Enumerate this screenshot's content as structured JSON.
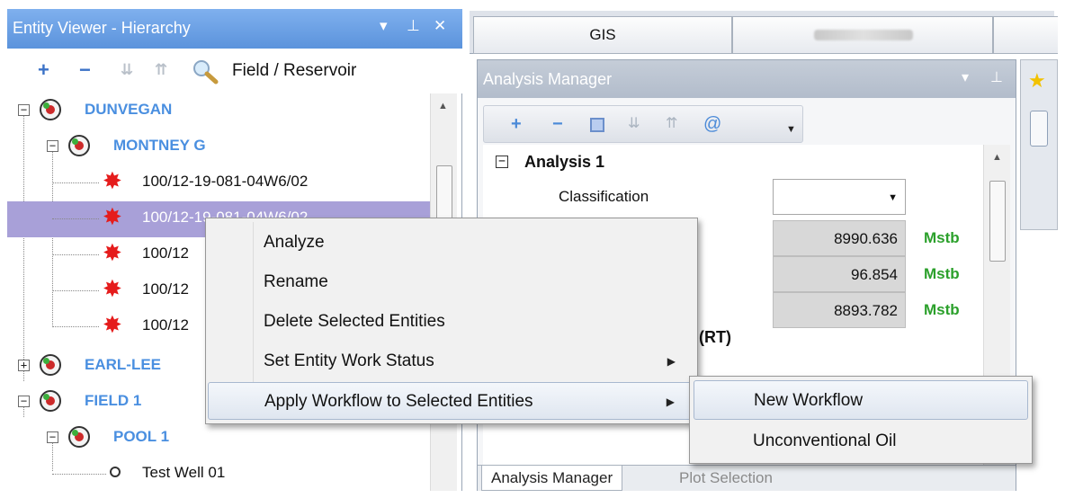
{
  "entity_viewer": {
    "title": "Entity Viewer - Hierarchy",
    "scope_label": "Field / Reservoir",
    "tree": [
      {
        "label": "DUNVEGAN",
        "kind": "group"
      },
      {
        "label": "MONTNEY G",
        "kind": "group"
      },
      {
        "label": "100/12-19-081-04W6/02",
        "kind": "well"
      },
      {
        "label": "100/12-19-081-04W6/02",
        "kind": "well",
        "selected": true
      },
      {
        "label": "100/12",
        "kind": "well"
      },
      {
        "label": "100/12",
        "kind": "well"
      },
      {
        "label": "100/12",
        "kind": "well"
      },
      {
        "label": "EARL-LEE",
        "kind": "group"
      },
      {
        "label": "FIELD 1",
        "kind": "group"
      },
      {
        "label": "POOL 1",
        "kind": "group"
      },
      {
        "label": "Test Well 01",
        "kind": "well"
      }
    ]
  },
  "top_tabs": [
    {
      "label": "GIS"
    },
    {
      "label": ""
    }
  ],
  "analysis_manager": {
    "title": "Analysis Manager",
    "analysis_name": "Analysis 1",
    "classification_label": "Classification",
    "classification_value": "",
    "values": [
      {
        "value": "8990.636",
        "unit": "Mstb"
      },
      {
        "value": "96.854",
        "unit": "Mstb"
      },
      {
        "value": "8893.782",
        "unit": "Mstb"
      }
    ],
    "rt_label": "(RT)",
    "bottom_tabs": [
      "Analysis Manager",
      "Plot Selection"
    ]
  },
  "context_menu": {
    "items": [
      {
        "label": "Analyze",
        "submenu": false
      },
      {
        "label": "Rename",
        "submenu": false
      },
      {
        "label": "Delete Selected Entities",
        "submenu": false
      },
      {
        "label": "Set Entity Work Status",
        "submenu": true
      },
      {
        "label": "Apply Workflow to Selected Entities",
        "submenu": true,
        "highlighted": true
      }
    ],
    "submenu": [
      {
        "label": "New Workflow",
        "highlighted": true
      },
      {
        "label": "Unconventional Oil"
      }
    ]
  },
  "colors": {
    "titlebar_active": "#5b93dc",
    "group_label": "#4a8fe0",
    "selection": "#a8a0d8",
    "unit_green": "#2ba02b",
    "well_star": "#e51c1c"
  }
}
